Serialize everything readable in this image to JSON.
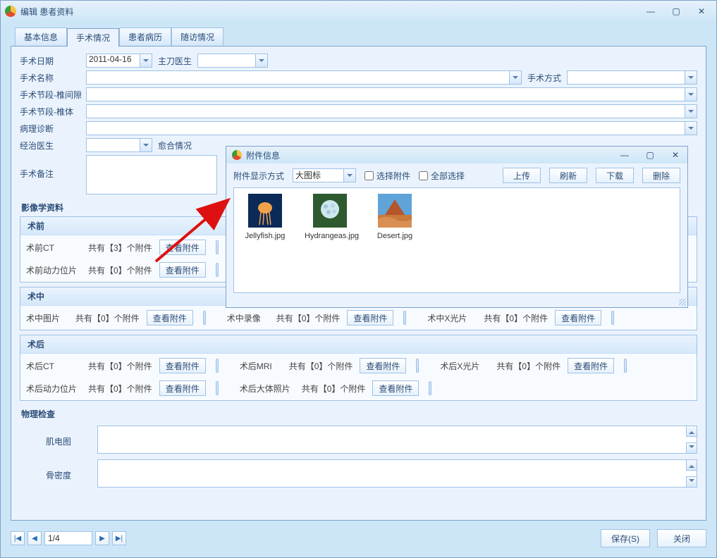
{
  "window": {
    "title": "编辑 患者资料"
  },
  "tabs": [
    "基本信息",
    "手术情况",
    "患者病历",
    "随访情况"
  ],
  "activeTab": 1,
  "form": {
    "surgery_date_label": "手术日期",
    "surgery_date_value": "2011-04-16",
    "surgeon_label": "主刀医生",
    "surgeon_value": "",
    "surgery_name_label": "手术名称",
    "surgery_name_value": "",
    "surgery_method_label": "手术方式",
    "surgery_method_value": "",
    "segment_intervertebral_label": "手术节段-椎间隙",
    "segment_intervertebral_value": "",
    "segment_vertebral_label": "手术节段-椎体",
    "segment_vertebral_value": "",
    "pathology_label": "病理诊断",
    "pathology_value": "",
    "attending_doctor_label": "经治医生",
    "attending_doctor_value": "",
    "healing_label": "愈合情况",
    "remark_label": "手术备注"
  },
  "imaging": {
    "section_title": "影像学资料",
    "view_btn": "查看附件",
    "preop": {
      "header": "术前",
      "items": [
        {
          "label": "术前CT",
          "count": "共有【3】个附件"
        },
        {
          "label": "术前动力位片",
          "count": "共有【0】个附件"
        }
      ]
    },
    "intraop": {
      "header": "术中",
      "items": [
        {
          "label": "术中图片",
          "count": "共有【0】个附件"
        },
        {
          "label": "术中录像",
          "count": "共有【0】个附件"
        },
        {
          "label": "术中X光片",
          "count": "共有【0】个附件"
        }
      ]
    },
    "postop": {
      "header": "术后",
      "items": [
        {
          "label": "术后CT",
          "count": "共有【0】个附件"
        },
        {
          "label": "术后MRI",
          "count": "共有【0】个附件"
        },
        {
          "label": "术后X光片",
          "count": "共有【0】个附件"
        },
        {
          "label": "术后动力位片",
          "count": "共有【0】个附件"
        },
        {
          "label": "术后大体照片",
          "count": "共有【0】个附件"
        }
      ]
    }
  },
  "physical": {
    "section_title": "物理检查",
    "emg_label": "肌电图",
    "bone_density_label": "骨密度"
  },
  "nav": {
    "page": "1/4"
  },
  "buttons": {
    "save": "保存(S)",
    "close": "关闭"
  },
  "popup": {
    "title": "附件信息",
    "display_mode_label": "附件显示方式",
    "display_mode_value": "大图标",
    "select_attachment": "选择附件",
    "select_all": "全部选择",
    "upload": "上传",
    "refresh": "刷新",
    "download": "下载",
    "delete": "删除",
    "files": [
      {
        "name": "Jellyfish.jpg"
      },
      {
        "name": "Hydrangeas.jpg"
      },
      {
        "name": "Desert.jpg"
      }
    ]
  }
}
